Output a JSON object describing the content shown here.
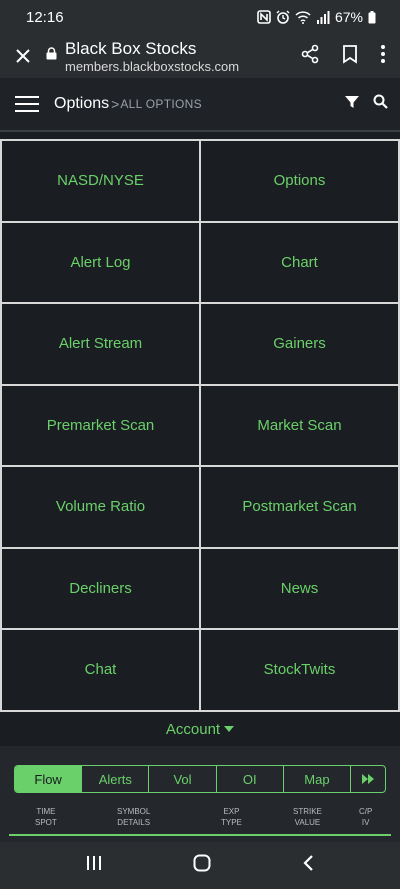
{
  "status": {
    "time": "12:16",
    "battery": "67%"
  },
  "browser": {
    "title": "Black Box Stocks",
    "url": "members.blackboxstocks.com"
  },
  "header": {
    "title": "Options",
    "separator": ">",
    "subtitle": "ALL OPTIONS"
  },
  "tiles": [
    "NASD/NYSE",
    "Options",
    "Alert Log",
    "Chart",
    "Alert Stream",
    "Gainers",
    "Premarket Scan",
    "Market Scan",
    "Volume Ratio",
    "Postmarket Scan",
    "Decliners",
    "News",
    "Chat",
    "StockTwits"
  ],
  "account": {
    "label": "Account"
  },
  "tabs": {
    "flow": "Flow",
    "alerts": "Alerts",
    "vol": "Vol",
    "oi": "OI",
    "map": "Map"
  },
  "columns": {
    "time": [
      "TIME",
      "SPOT"
    ],
    "symbol": [
      "SYMBOL",
      "DETAILS"
    ],
    "exp": [
      "EXP",
      "TYPE"
    ],
    "strike": [
      "STRIKE",
      "VALUE"
    ],
    "cp": [
      "C/P",
      "IV"
    ]
  },
  "colors": {
    "accent": "#6ad06a",
    "background": "#1a1d21"
  }
}
